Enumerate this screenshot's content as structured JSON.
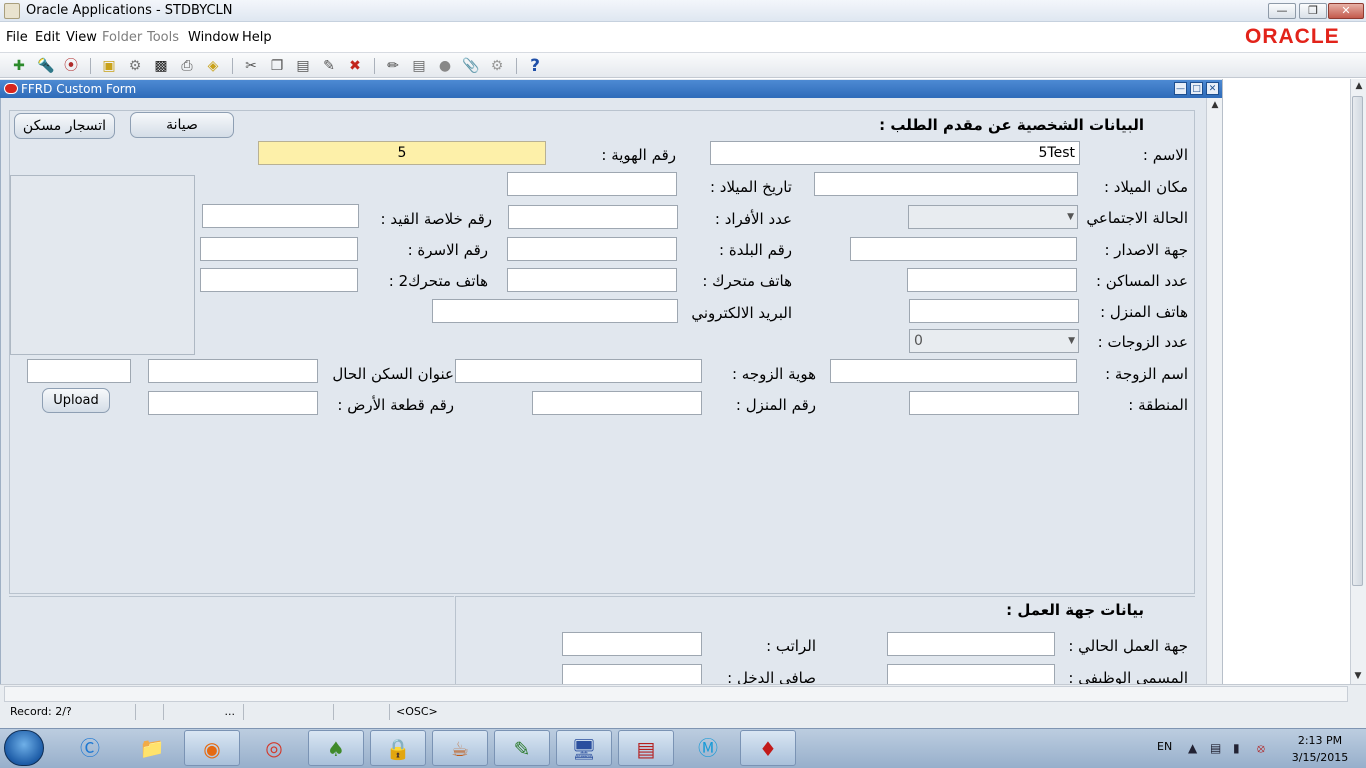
{
  "window": {
    "title": "Oracle Applications - STDBYCLN"
  },
  "menu": {
    "items": [
      "File",
      "Edit",
      "View",
      "Folder",
      "Tools",
      "Window",
      "Help"
    ],
    "disabled": [
      "Folder",
      "Tools"
    ]
  },
  "brand": {
    "logo_text": "ORACLE",
    "color": "#e2231a"
  },
  "toolbar": {
    "help_glyph": "?",
    "icons": [
      "new-record-icon",
      "find-icon",
      "navigator-icon",
      "save-icon",
      "next-step-icon",
      "print-icon",
      "close-form-icon",
      "cut-icon",
      "copy-icon",
      "paste-icon",
      "clear-record-icon",
      "delete-record-icon",
      "edit-field-icon",
      "zoom-icon",
      "translations-icon",
      "attachments-icon",
      "folder-tools-icon",
      "help-icon"
    ]
  },
  "form": {
    "title": "FFRD Custom Form",
    "buttons": {
      "maintenance": "صيانة",
      "rent_housing": "اتسجار مسكن",
      "upload": "Upload"
    },
    "personal_heading": "البيانات الشخصية عن مقدم الطلب :",
    "labels": {
      "name": "الاسم :",
      "id_number": "رقم الهوية :",
      "birth_place": "مكان الميلاد :",
      "birth_date": "تاريخ الميلاد :",
      "marital_status": "الحالة الاجتماعي",
      "family_count": "عدد الأفراد :",
      "registry_summary": "رقم خلاصة القيد :",
      "issue_authority": "جهة الاصدار :",
      "town_number": "رقم البلدة :",
      "family_number": "رقم الاسرة :",
      "dwellings_count": "عدد المساكن :",
      "mobile": "هاتف متحرك :",
      "mobile2": "هاتف متحرك2 :",
      "home_phone": "هاتف المنزل :",
      "email": "البريد الالكتروني",
      "wives_count": "عدد الزوجات :",
      "wife_name": "اسم الزوجة :",
      "wife_id": "هوية الزوجه :",
      "current_address": "عنوان السكن الحال",
      "region": "المنطقة :",
      "house_number": "رقم المنزل :",
      "land_plot": "رقم قطعة الأرض :"
    },
    "values": {
      "name": "5Test",
      "id_number": "5",
      "wives_count": "0"
    },
    "work_heading": "بيانات جهة العمل :",
    "work_labels": {
      "current_employer": "جهة العمل الحالي :",
      "salary": "الراتب :",
      "job_title": "المسمى الوظيفي :",
      "net_income": "صافي الدخل :"
    }
  },
  "status": {
    "record": "Record: 2/?",
    "ellipsis": "...",
    "mode": "<OSC>"
  },
  "taskbar": {
    "lang": "EN",
    "time": "2:13 PM",
    "date": "3/15/2015"
  }
}
